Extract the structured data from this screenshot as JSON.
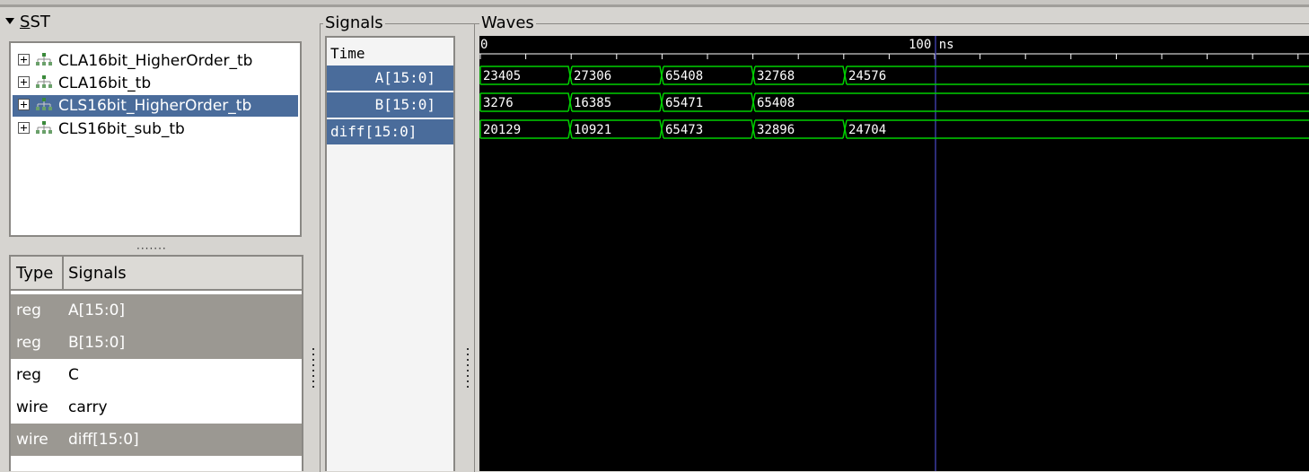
{
  "sst": {
    "title_prefix": "",
    "title_underlined": "S",
    "title_rest": "ST",
    "tree": [
      {
        "label": "CLA16bit_HigherOrder_tb",
        "selected": false
      },
      {
        "label": "CLA16bit_tb",
        "selected": false
      },
      {
        "label": "CLS16bit_HigherOrder_tb",
        "selected": true
      },
      {
        "label": "CLS16bit_sub_tb",
        "selected": false
      }
    ],
    "splitter": "·······",
    "table": {
      "headers": {
        "type": "Type",
        "signals": "Signals"
      },
      "rows": [
        {
          "type": "reg",
          "signal": "A[15:0]",
          "highlighted": true
        },
        {
          "type": "reg",
          "signal": "B[15:0]",
          "highlighted": true
        },
        {
          "type": "reg",
          "signal": "C",
          "highlighted": false
        },
        {
          "type": "wire",
          "signal": "carry",
          "highlighted": false
        },
        {
          "type": "wire",
          "signal": "diff[15:0]",
          "highlighted": true
        }
      ]
    }
  },
  "signals": {
    "title": "Signals",
    "time_label": "Time",
    "items": [
      {
        "label": "A[15:0]"
      },
      {
        "label": "B[15:0]"
      },
      {
        "label": "diff[15:0]"
      }
    ]
  },
  "waves": {
    "title": "Waves",
    "ruler_start": "0",
    "ruler_marker": "100 ns",
    "traces": [
      {
        "name": "A",
        "values": [
          "23405",
          "27306",
          "65408",
          "32768",
          "24576"
        ]
      },
      {
        "name": "B",
        "values": [
          "3276",
          "16385",
          "65471",
          "65408"
        ]
      },
      {
        "name": "diff",
        "values": [
          "20129",
          "10921",
          "65473",
          "32896",
          "24704"
        ]
      }
    ]
  },
  "colors": {
    "wave": "#00d000",
    "selection": "#4a6c9b",
    "highlight_row": "#9b9892",
    "marker_line": "#3a3aa0"
  }
}
